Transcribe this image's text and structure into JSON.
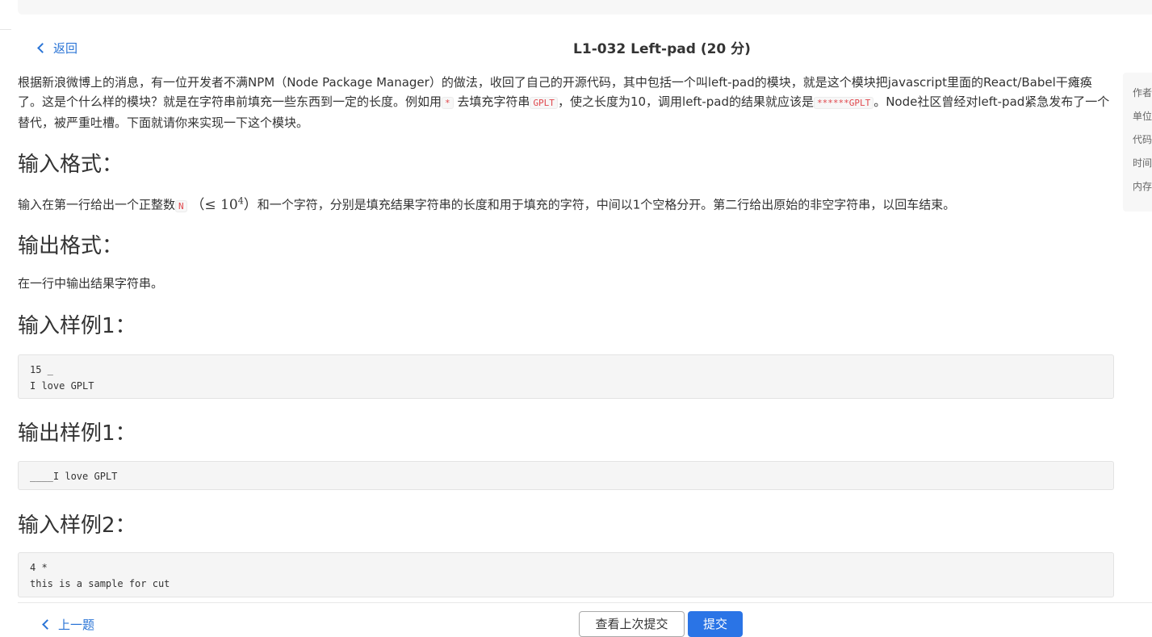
{
  "header": {
    "back_label": "返回",
    "title": "L1-032 Left-pad (20 分)"
  },
  "description": {
    "part1": "根据新浪微博上的消息，有一位开发者不满NPM（Node Package Manager）的做法，收回了自己的开源代码，其中包括一个叫left-pad的模块，就是这个模块把javascript里面的React/Babel干瘫痪了。这是个什么样的模块？就是在字符串前填充一些东西到一定的长度。例如用",
    "code1": "*",
    "part2": "去填充字符串",
    "code2": "GPLT",
    "part3": "，使之长度为10，调用left-pad的结果就应该是",
    "code3": "******GPLT",
    "part4": "。Node社区曾经对left-pad紧急发布了一个替代，被严重吐槽。下面就请你来实现一下这个模块。"
  },
  "input_format": {
    "heading": "输入格式：",
    "part1": "输入在第一行给出一个正整数",
    "code": "N",
    "math_open": "（≤ 10",
    "math_exp": "4",
    "math_close": "）",
    "part2": "和一个字符，分别是填充结果字符串的长度和用于填充的字符，中间以1个空格分开。第二行给出原始的非空字符串，以回车结束。"
  },
  "output_format": {
    "heading": "输出格式：",
    "text": "在一行中输出结果字符串。"
  },
  "samples": [
    {
      "heading": "输入样例1：",
      "content": "15 _\nI love GPLT"
    },
    {
      "heading": "输出样例1：",
      "content": "____I love GPLT"
    },
    {
      "heading": "输入样例2：",
      "content": "4 *\nthis is a sample for cut"
    }
  ],
  "side_panel": {
    "items": [
      "作者",
      "单位",
      "代码",
      "时间",
      "内存"
    ]
  },
  "footer": {
    "prev_label": "上一题",
    "view_last_label": "查看上次提交",
    "submit_label": "提交"
  }
}
